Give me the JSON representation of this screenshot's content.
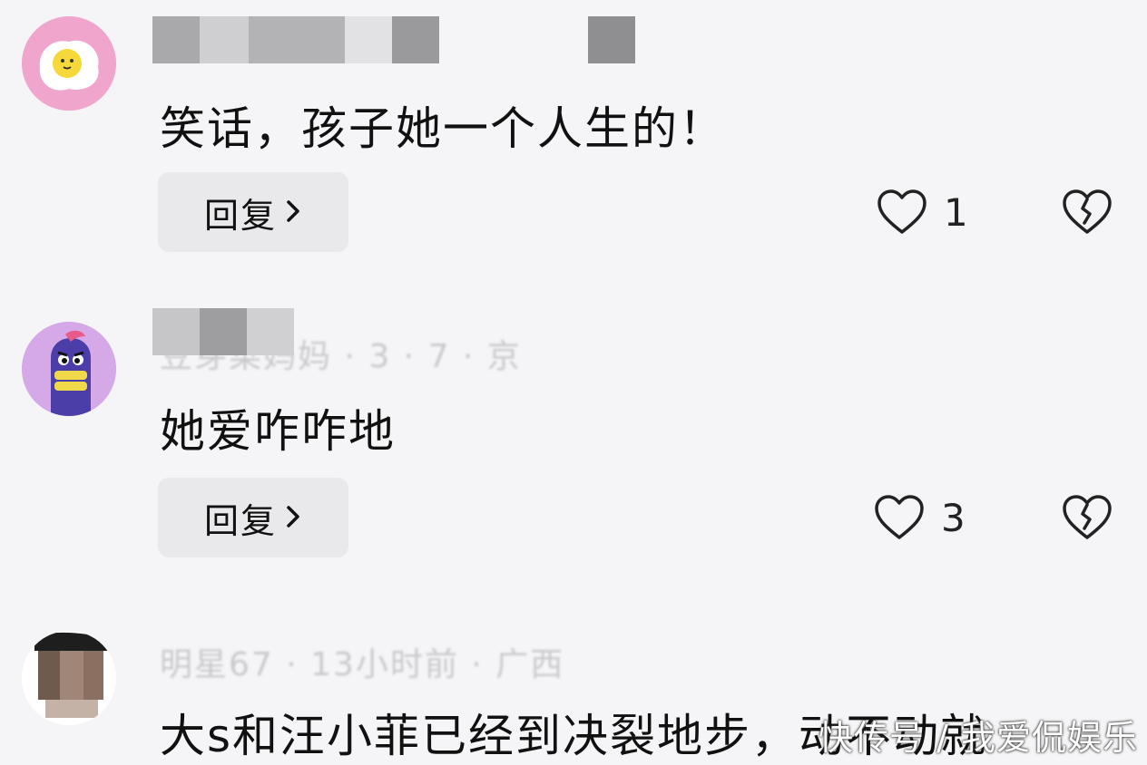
{
  "comments": [
    {
      "avatar_icon": "fried-egg-icon",
      "text": "笑话，孩子她一个人生的！",
      "reply_label": "回复",
      "like_count": "1"
    },
    {
      "avatar_icon": "purple-monster-icon",
      "meta": "豆芽菜妈妈 · 3 · 7 · 京",
      "text": "她爱咋咋地",
      "reply_label": "回复",
      "like_count": "3"
    },
    {
      "avatar_icon": "person-photo-icon",
      "meta": "明星67 · 13小时前 · 广西",
      "text": "大s和汪小菲已经到决裂地步，动不动就"
    }
  ],
  "watermark": "快传号 / 我爱侃娱乐",
  "colors": {
    "background": "#f5f5f7",
    "reply_button": "#e9e9ec",
    "text": "#111111"
  }
}
